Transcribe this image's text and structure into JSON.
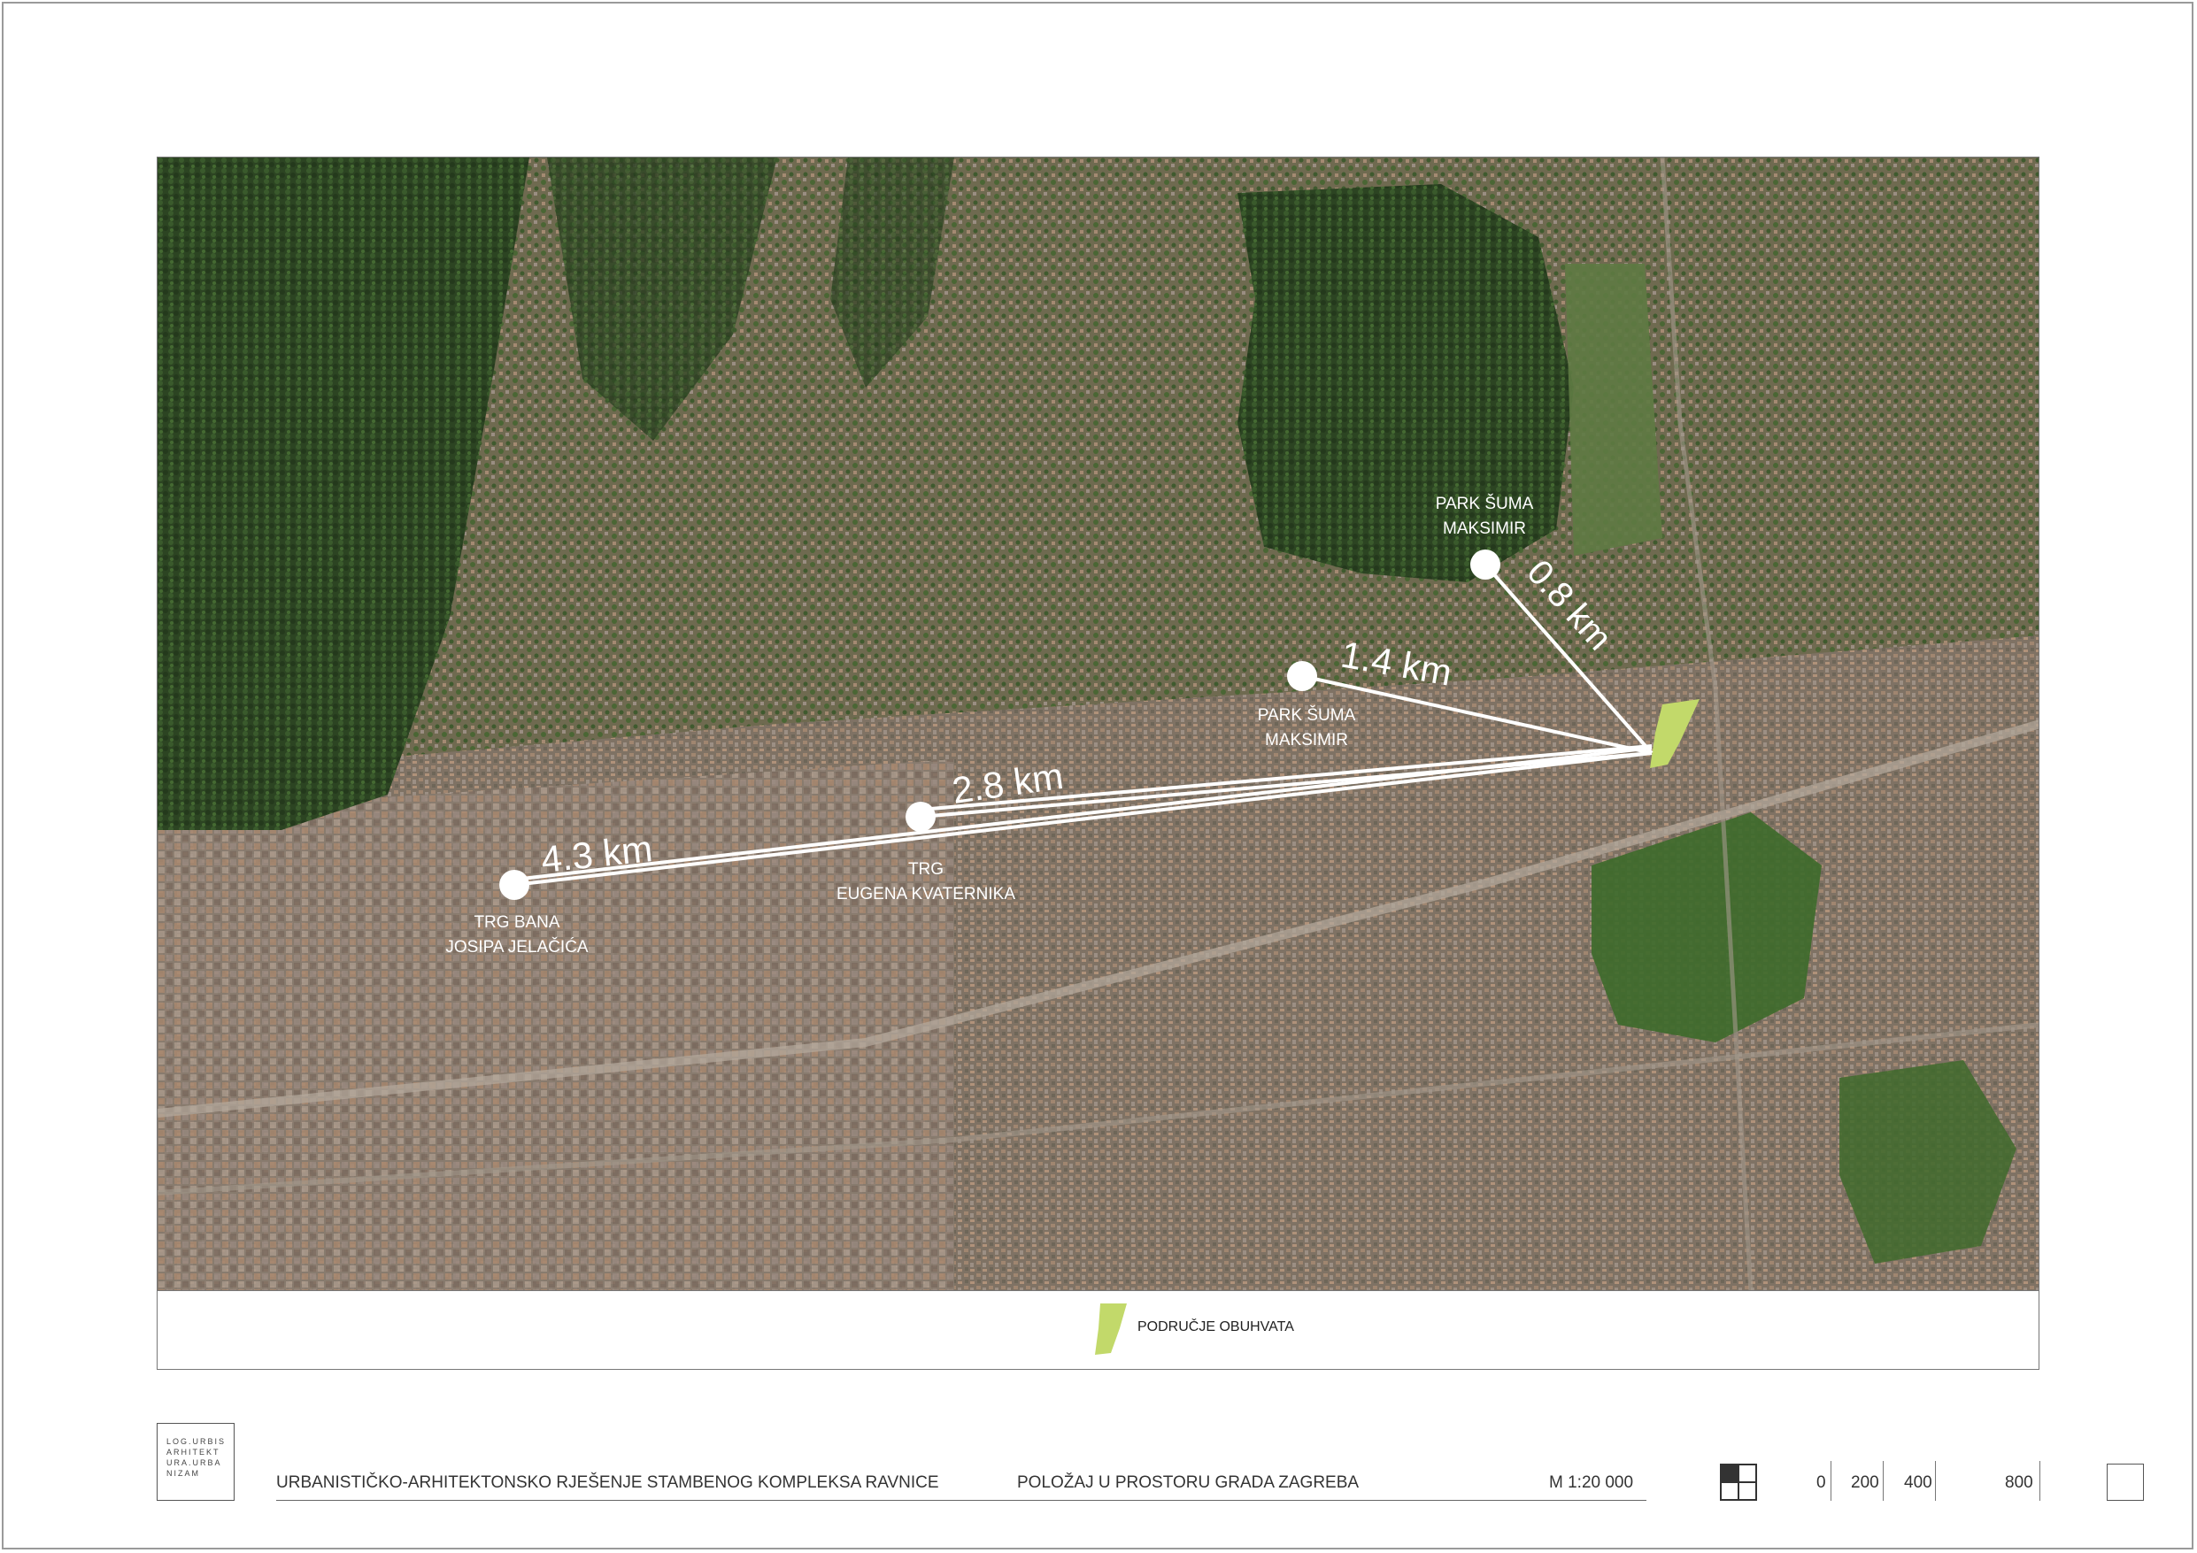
{
  "map": {
    "labels": {
      "park_north_l1": "PARK ŠUMA",
      "park_north_l2": "MAKSIMIR",
      "park_south_l1": "PARK ŠUMA",
      "park_south_l2": "MAKSIMIR",
      "kvaternik_l1": "TRG",
      "kvaternik_l2": "EUGENA KVATERNIKA",
      "jelacic_l1": "TRG BANA",
      "jelacic_l2": "JOSIPA JELAČIĆA"
    },
    "distances": {
      "d1": "0.8 km",
      "d2": "1.4 km",
      "d3": "2.8 km",
      "d4": "4.3 km"
    },
    "colors": {
      "site": "#c2d96a",
      "line": "#ffffff",
      "vegetation": "#2f4a24",
      "urban": "#8a7866"
    }
  },
  "legend": {
    "label": "PODRUČJE OBUHVATA"
  },
  "title_block": {
    "logo_text": "LOG.URBIS\nARHITEKT\nURA.URBA\nNIZAM",
    "project": "URBANISTIČKO-ARHITEKTONSKO RJEŠENJE STAMBENOG KOMPLEKSA RAVNICE",
    "sheet": "POLOŽAJ U PROSTORU GRADA ZAGREBA",
    "scale": "M 1:20 000",
    "scale_bar": [
      "0",
      "200",
      "400",
      "800"
    ]
  }
}
